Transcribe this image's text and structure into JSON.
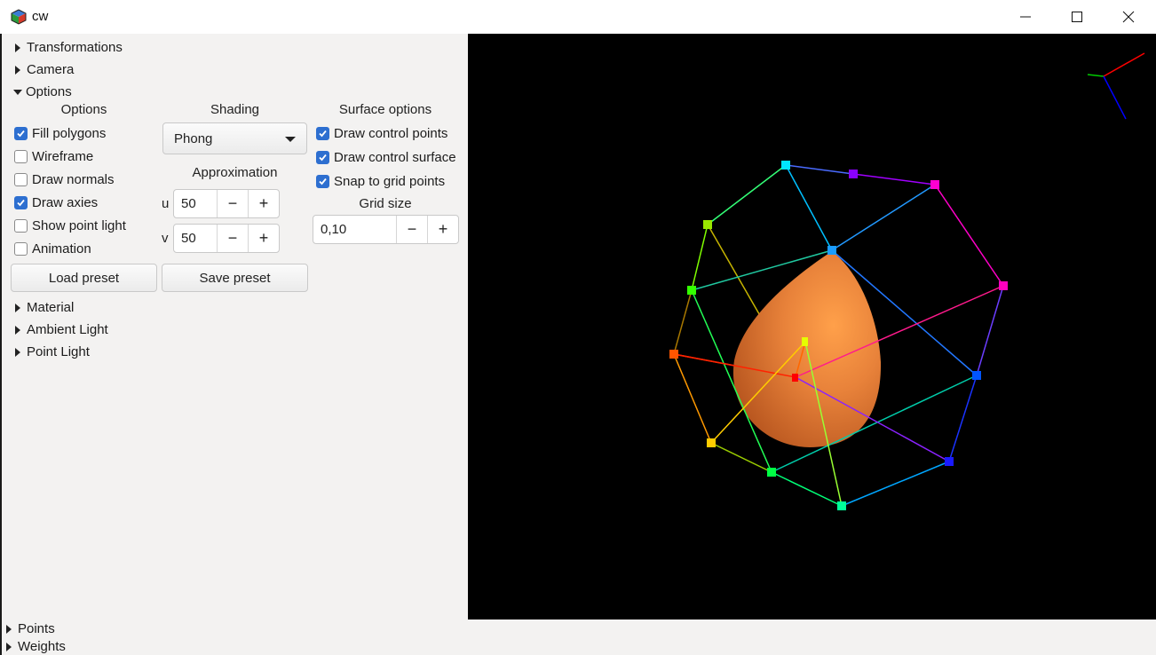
{
  "window": {
    "title": "cw",
    "minimize_icon": "minimize-icon",
    "maximize_icon": "maximize-icon",
    "close_icon": "close-icon"
  },
  "tree": {
    "transformations": "Transformations",
    "camera": "Camera",
    "options": "Options",
    "material": "Material",
    "ambient_light": "Ambient Light",
    "point_light": "Point Light"
  },
  "options": {
    "header": "Options",
    "fill_polygons": {
      "label": "Fill polygons",
      "checked": true
    },
    "wireframe": {
      "label": "Wireframe",
      "checked": false
    },
    "draw_normals": {
      "label": "Draw normals",
      "checked": false
    },
    "draw_axies": {
      "label": "Draw axies",
      "checked": true
    },
    "show_point_light": {
      "label": "Show point light",
      "checked": false
    },
    "animation": {
      "label": "Animation",
      "checked": false
    }
  },
  "shading": {
    "header": "Shading",
    "selected": "Phong"
  },
  "approximation": {
    "header": "Approximation",
    "u_label": "u",
    "u_value": "50",
    "v_label": "v",
    "v_value": "50"
  },
  "surface": {
    "header": "Surface options",
    "draw_control_points": {
      "label": "Draw control points",
      "checked": true
    },
    "draw_control_surface": {
      "label": "Draw control surface",
      "checked": true
    },
    "snap_to_grid": {
      "label": "Snap to grid points",
      "checked": true
    },
    "grid_size_label": "Grid size",
    "grid_size_value": "0,10"
  },
  "buttons": {
    "load_preset": "Load preset",
    "save_preset": "Save preset",
    "minus": "−",
    "plus": "+"
  },
  "bottom": {
    "points": "Points",
    "weights": "Weights"
  },
  "viewport": {
    "background": "#000000",
    "surface_color": "#e8823a",
    "axis_colors": {
      "x": "#ff0000",
      "y": "#00cc00",
      "z": "#0000ff"
    }
  }
}
